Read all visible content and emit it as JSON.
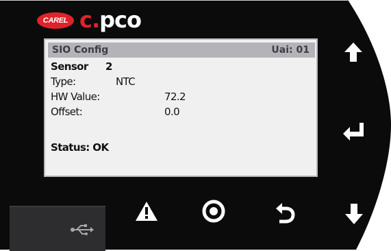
{
  "brand": {
    "logo_text": "CAREL",
    "product_c": "c.",
    "product_pco": "pco"
  },
  "screen": {
    "title": "SIO Config",
    "uai": "Uai: 01",
    "sensor_label": "Sensor",
    "sensor_value": "2",
    "type_label": "Type:",
    "type_value": "NTC",
    "hw_label": "HW Value:",
    "hw_value": "72.2",
    "offset_label": "Offset:",
    "offset_value": "0.0",
    "status": "Status: OK"
  },
  "keys": [
    "up-arrow-icon",
    "enter-icon",
    "down-arrow-icon",
    "escape-icon",
    "program-icon",
    "alarm-icon",
    "usb-icon"
  ],
  "colors": {
    "bezel": "#0b0b0c",
    "lcd": "#f0f0f1",
    "title_bar": "#b4b4b8",
    "brand_red": "#e0232a"
  }
}
